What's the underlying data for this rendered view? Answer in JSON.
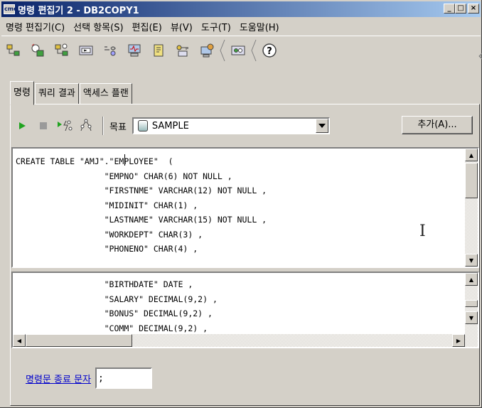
{
  "window": {
    "title": "명령 편집기 2 - DB2COPY1",
    "app_icon": "cmd",
    "min_glyph": "_",
    "max_glyph": "□",
    "close_glyph": "×"
  },
  "menus": [
    "명령 편집기(C)",
    "선택 항목(S)",
    "편집(E)",
    "뷰(V)",
    "도구(T)",
    "도움말(H)"
  ],
  "toolbar_icons": [
    "control-center-icon",
    "replication-center-icon",
    "satellite-admin-icon",
    "command-editor-icon",
    "task-center-icon",
    "health-center-icon",
    "journal-icon",
    "license-center-icon",
    "development-center-icon",
    "tools-settings-icon",
    "help-icon"
  ],
  "tabs": [
    "명령",
    "쿼리 결과",
    "액세스 플랜"
  ],
  "runbar": {
    "target_label": "목표",
    "target_value": "SAMPLE",
    "add_button": "추가(A)..."
  },
  "editor_top": {
    "code": "CREATE TABLE \"AMJ\".\"EMPLOYEE\"  (\n                  \"EMPNO\" CHAR(6) NOT NULL ,\n                  \"FIRSTNME\" VARCHAR(12) NOT NULL ,\n                  \"MIDINIT\" CHAR(1) ,\n                  \"LASTNAME\" VARCHAR(15) NOT NULL ,\n                  \"WORKDEPT\" CHAR(3) ,\n                  \"PHONENO\" CHAR(4) ,"
  },
  "editor_bottom": {
    "code": "                  \"BIRTHDATE\" DATE ,\n                  \"SALARY\" DECIMAL(9,2) ,\n                  \"BONUS\" DECIMAL(9,2) ,\n                  \"COMM\" DECIMAL(9,2) ,"
  },
  "terminator": {
    "label": "명령문 종료 문자",
    "value": ";"
  },
  "colors": {
    "title_start": "#0a246a",
    "title_end": "#a6caf0",
    "face": "#d4d0c8",
    "link": "#0000cc",
    "run_green": "#1fa31f"
  }
}
